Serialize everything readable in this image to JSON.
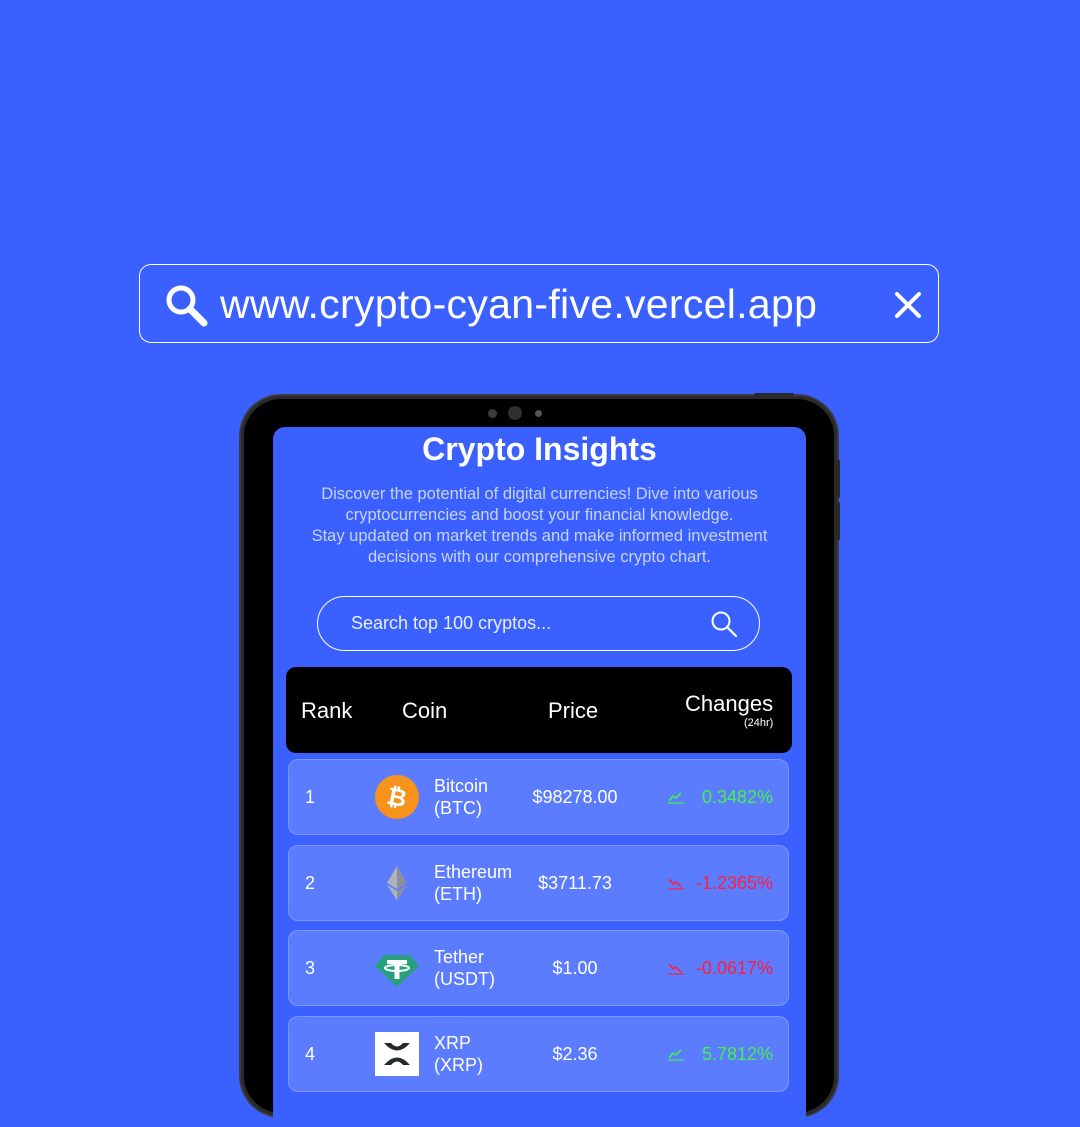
{
  "browser": {
    "url": "www.crypto-cyan-five.vercel.app"
  },
  "app": {
    "title": "Crypto Insights",
    "description_line1": "Discover the potential of digital currencies! Dive into various cryptocurrencies and boost your financial knowledge.",
    "description_line2": "Stay updated on market trends and make informed investment decisions with our comprehensive crypto chart.",
    "search_placeholder": "Search top 100 cryptos..."
  },
  "table": {
    "headers": {
      "rank": "Rank",
      "coin": "Coin",
      "price": "Price",
      "changes": "Changes",
      "changes_sub": "(24hr)"
    },
    "rows": [
      {
        "rank": "1",
        "name": "Bitcoin",
        "symbol": "(BTC)",
        "price": "$98278.00",
        "change": "0.3482%",
        "direction": "up",
        "icon": "bitcoin-logo"
      },
      {
        "rank": "2",
        "name": "Ethereum",
        "symbol": "(ETH)",
        "price": "$3711.73",
        "change": "-1.2365%",
        "direction": "down",
        "icon": "ethereum-logo"
      },
      {
        "rank": "3",
        "name": "Tether",
        "symbol": "(USDT)",
        "price": "$1.00",
        "change": "-0.0617%",
        "direction": "down",
        "icon": "tether-logo"
      },
      {
        "rank": "4",
        "name": "XRP",
        "symbol": "(XRP)",
        "price": "$2.36",
        "change": "5.7812%",
        "direction": "up",
        "icon": "xrp-logo"
      }
    ]
  },
  "colors": {
    "background": "#3a61ff",
    "row_background": "#5b7cff",
    "positive": "#45f04a",
    "negative": "#ff1f3a"
  }
}
